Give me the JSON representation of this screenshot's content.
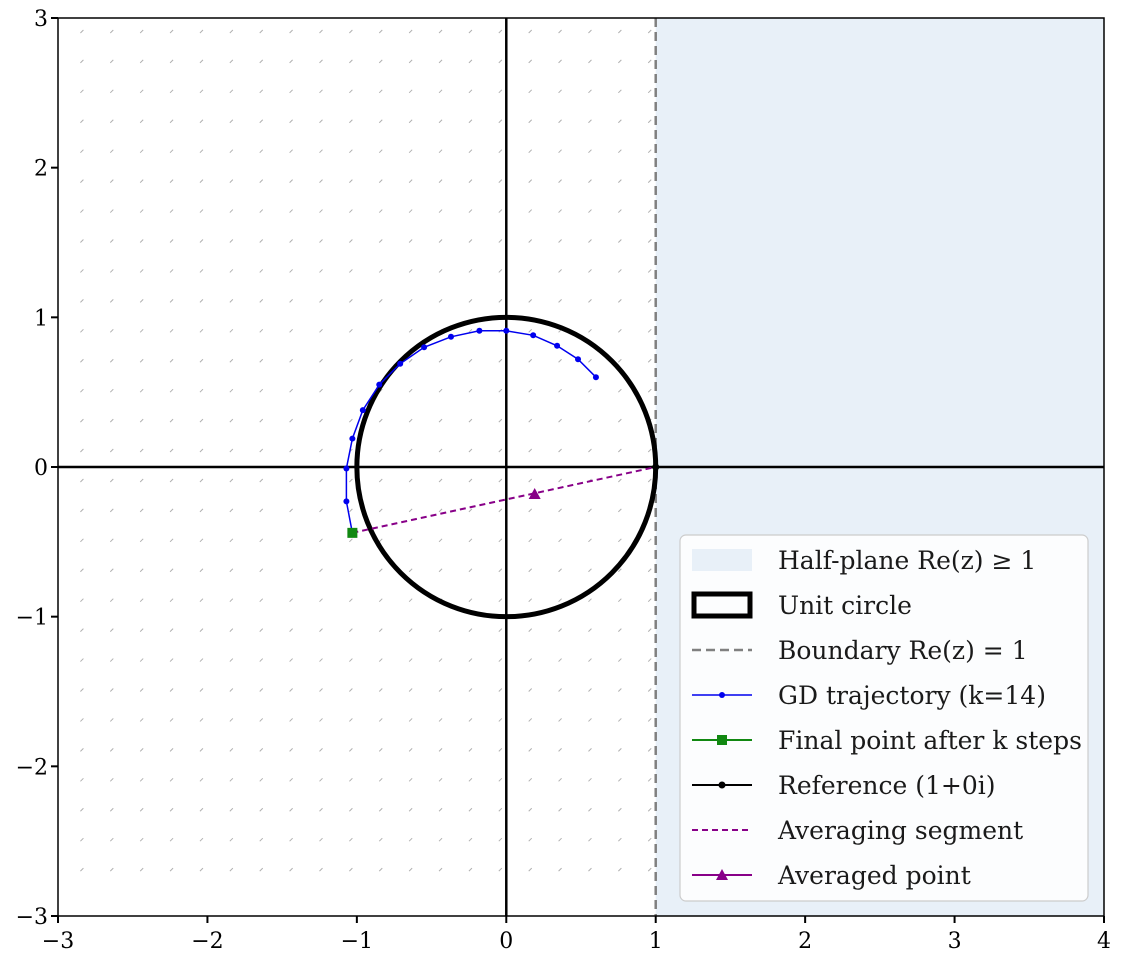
{
  "chart_data": {
    "type": "line",
    "xlim": [
      -3,
      4
    ],
    "ylim": [
      -3,
      3
    ],
    "x_ticks": [
      -3,
      -2,
      -1,
      0,
      1,
      2,
      3,
      4
    ],
    "y_ticks": [
      -3,
      -2,
      -1,
      0,
      1,
      2,
      3
    ],
    "x_tick_labels": [
      "−3",
      "−2",
      "−1",
      "0",
      "1",
      "2",
      "3",
      "4"
    ],
    "y_tick_labels": [
      "−3",
      "−2",
      "−1",
      "0",
      "1",
      "2",
      "3"
    ],
    "grid": false,
    "legend_position": "lower-right",
    "colors": {
      "half_plane": "#e8f0f8",
      "unit_circle": "#000000",
      "boundary": "#808080",
      "trajectory": "#0000ee",
      "final_point": "#118811",
      "reference": "#000000",
      "averaging": "#880088",
      "quiver": "#b0b0b0"
    },
    "half_plane": {
      "name": "Half-plane Re(z) ≥ 1",
      "x_min": 1
    },
    "unit_circle": {
      "name": "Unit circle",
      "center": [
        0,
        0
      ],
      "radius": 1
    },
    "boundary": {
      "name": "Boundary Re(z) = 1",
      "x": 1
    },
    "trajectory": {
      "name": "GD trajectory (k=14)",
      "points": [
        [
          0.6,
          0.6
        ],
        [
          0.48,
          0.72
        ],
        [
          0.34,
          0.81
        ],
        [
          0.18,
          0.88
        ],
        [
          0.0,
          0.91
        ],
        [
          -0.18,
          0.91
        ],
        [
          -0.37,
          0.87
        ],
        [
          -0.55,
          0.8
        ],
        [
          -0.71,
          0.69
        ],
        [
          -0.85,
          0.55
        ],
        [
          -0.96,
          0.38
        ],
        [
          -1.03,
          0.19
        ],
        [
          -1.07,
          -0.01
        ],
        [
          -1.07,
          -0.23
        ],
        [
          -1.03,
          -0.44
        ]
      ]
    },
    "final_point": {
      "name": "Final point after k steps",
      "x": -1.03,
      "y": -0.44
    },
    "reference": {
      "name": "Reference (1+0i)",
      "x": 1,
      "y": 0
    },
    "averaging_segment": {
      "name": "Averaging segment",
      "from": [
        -1.03,
        -0.44
      ],
      "to": [
        1,
        0
      ]
    },
    "averaged_point": {
      "name": "Averaged point",
      "x": 0.19,
      "y": -0.18
    },
    "legend": [
      "Half-plane Re(z) ≥ 1",
      "Unit circle",
      "Boundary Re(z) = 1",
      "GD trajectory (k=14)",
      "Final point after k steps",
      "Reference (1+0i)",
      "Averaging segment",
      "Averaged point"
    ]
  }
}
